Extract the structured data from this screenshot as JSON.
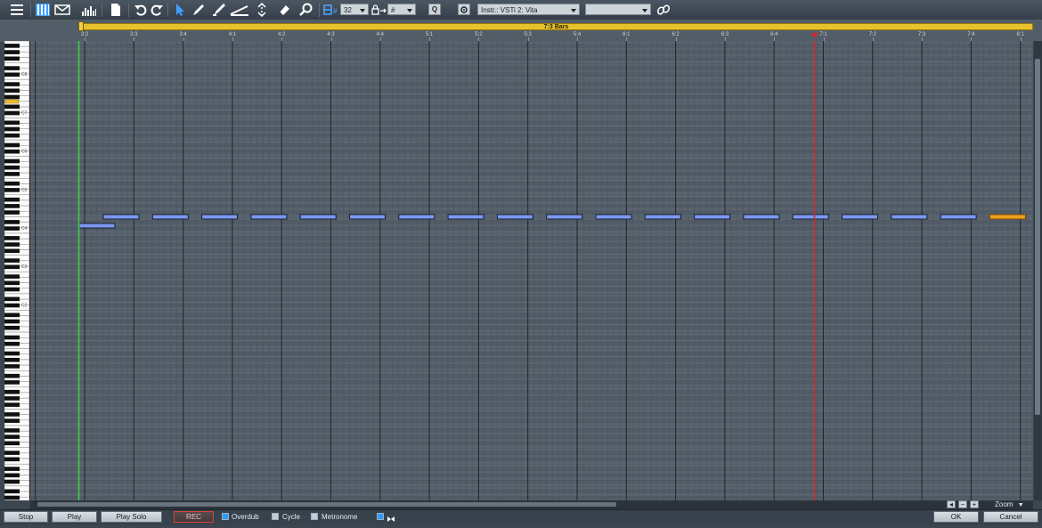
{
  "toolbar": {
    "grid_value": "32",
    "lock_value": "#",
    "quantize_label": "Q",
    "instrument": "Instr.: VSTi 2: Vita",
    "secondary_select": ""
  },
  "range": {
    "label": "7:3 Bars"
  },
  "ruler": {
    "labels": [
      "3:2",
      "3:3",
      "3:4",
      "4:1",
      "4:2",
      "4:3",
      "4:4",
      "5:1",
      "5:2",
      "5:3",
      "5:4",
      "6:1",
      "6:2",
      "6:3",
      "6:4",
      "7:1",
      "7:2",
      "7:3",
      "7:4",
      "8:1"
    ]
  },
  "keyboard": {
    "octave_labels": [
      "C8",
      "C7",
      "C6",
      "C5",
      "C4",
      "C3",
      "C2"
    ]
  },
  "notes": {
    "pattern": "repeated eighth-note length events on one pitch, one starting pitch below",
    "first_note_row_below": 1,
    "repeated_count": 19,
    "selected_last": true
  },
  "colors": {
    "note_fill": "#7b98f2",
    "note_selected": "#f0a020",
    "playhead": "#3cd24a",
    "marker": "#d8262e",
    "range": "#e7c22c"
  },
  "zoom": {
    "label": "Zoom"
  },
  "transport": {
    "stop": "Stop",
    "play": "Play",
    "play_solo": "Play Solo",
    "rec": "REC",
    "overdub": "Overdub",
    "cycle": "Cycle",
    "metronome": "Metronome",
    "ok": "OK",
    "cancel": "Cancel"
  }
}
